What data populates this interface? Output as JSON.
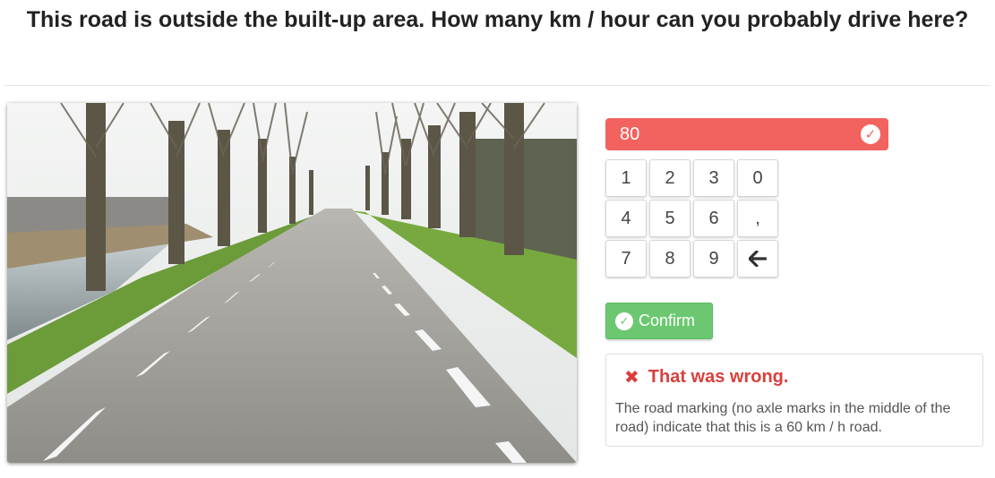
{
  "question": "This road is outside the built-up area. How many km / hour can you probably drive here?",
  "image": {
    "caption": ""
  },
  "answer": {
    "value": "80",
    "status_icon": "check-circle-icon"
  },
  "keypad": {
    "keys": [
      "1",
      "2",
      "3",
      "0",
      "4",
      "5",
      "6",
      ",",
      "7",
      "8",
      "9"
    ],
    "backspace_icon": "arrow-left-icon"
  },
  "confirm": {
    "label": "Confirm",
    "icon": "check-circle-icon"
  },
  "feedback": {
    "title": "That was wrong.",
    "icon": "x-icon",
    "text": "The road marking (no axle marks in the middle of the road) indicate that this is a 60 km / h road."
  },
  "colors": {
    "wrong_red": "#f2625f",
    "confirm_green": "#6cc870",
    "feedback_red": "#d9403c"
  }
}
